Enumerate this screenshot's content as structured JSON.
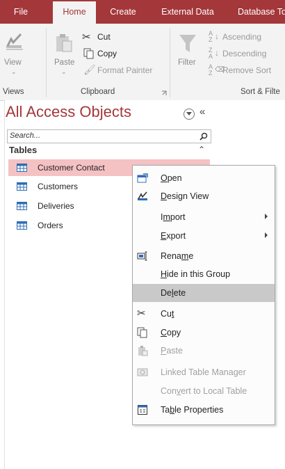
{
  "tabs": [
    {
      "label": "File"
    },
    {
      "label": "Home"
    },
    {
      "label": "Create"
    },
    {
      "label": "External Data"
    },
    {
      "label": "Database To"
    }
  ],
  "ribbon": {
    "views": {
      "view_label": "View",
      "group_label": "Views"
    },
    "clipboard": {
      "paste_label": "Paste",
      "cut_label": "Cut",
      "copy_label": "Copy",
      "format_painter_label": "Format Painter",
      "group_label": "Clipboard"
    },
    "sort_filter": {
      "filter_label": "Filter",
      "ascending_label": "Ascending",
      "descending_label": "Descending",
      "remove_sort_label": "Remove Sort",
      "group_label": "Sort & Filte"
    }
  },
  "nav_pane": {
    "title": "All Access Objects",
    "search_placeholder": "Search...",
    "section": "Tables",
    "items": [
      {
        "label": "Customer Contact",
        "selected": true
      },
      {
        "label": "Customers"
      },
      {
        "label": "Deliveries"
      },
      {
        "label": "Orders"
      }
    ]
  },
  "context_menu": {
    "open": {
      "pre": "",
      "u": "O",
      "post": "pen"
    },
    "design_view": {
      "pre": "",
      "u": "D",
      "post": "esign View"
    },
    "import": {
      "pre": "I",
      "u": "m",
      "post": "port"
    },
    "export": {
      "pre": "",
      "u": "E",
      "post": "xport"
    },
    "rename": {
      "pre": "Rena",
      "u": "m",
      "post": "e"
    },
    "hide": {
      "pre": "",
      "u": "H",
      "post": "ide in this Group"
    },
    "delete": {
      "pre": "De",
      "u": "l",
      "post": "ete"
    },
    "cut": {
      "pre": "Cu",
      "u": "t",
      "post": ""
    },
    "copy": {
      "pre": "",
      "u": "C",
      "post": "opy"
    },
    "paste": {
      "pre": "",
      "u": "P",
      "post": "aste"
    },
    "linked": {
      "pre": "Linked Table Manager",
      "u": "",
      "post": ""
    },
    "convert": {
      "pre": "Con",
      "u": "v",
      "post": "ert to Local Table"
    },
    "properties": {
      "pre": "Ta",
      "u": "b",
      "post": "le Properties"
    }
  },
  "colors": {
    "accent": "#a4373a",
    "selection": "#f5c2c4",
    "menu_highlight": "#c9c9c9"
  }
}
